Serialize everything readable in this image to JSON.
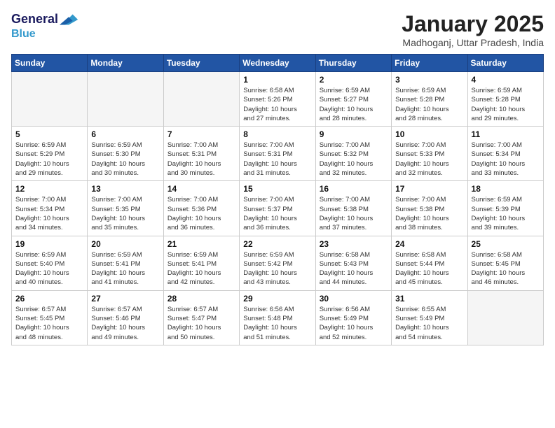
{
  "header": {
    "logo_line1": "General",
    "logo_line2": "Blue",
    "month": "January 2025",
    "location": "Madhoganj, Uttar Pradesh, India"
  },
  "days_of_week": [
    "Sunday",
    "Monday",
    "Tuesday",
    "Wednesday",
    "Thursday",
    "Friday",
    "Saturday"
  ],
  "weeks": [
    [
      {
        "day": "",
        "info": ""
      },
      {
        "day": "",
        "info": ""
      },
      {
        "day": "",
        "info": ""
      },
      {
        "day": "1",
        "info": "Sunrise: 6:58 AM\nSunset: 5:26 PM\nDaylight: 10 hours\nand 27 minutes."
      },
      {
        "day": "2",
        "info": "Sunrise: 6:59 AM\nSunset: 5:27 PM\nDaylight: 10 hours\nand 28 minutes."
      },
      {
        "day": "3",
        "info": "Sunrise: 6:59 AM\nSunset: 5:28 PM\nDaylight: 10 hours\nand 28 minutes."
      },
      {
        "day": "4",
        "info": "Sunrise: 6:59 AM\nSunset: 5:28 PM\nDaylight: 10 hours\nand 29 minutes."
      }
    ],
    [
      {
        "day": "5",
        "info": "Sunrise: 6:59 AM\nSunset: 5:29 PM\nDaylight: 10 hours\nand 29 minutes."
      },
      {
        "day": "6",
        "info": "Sunrise: 6:59 AM\nSunset: 5:30 PM\nDaylight: 10 hours\nand 30 minutes."
      },
      {
        "day": "7",
        "info": "Sunrise: 7:00 AM\nSunset: 5:31 PM\nDaylight: 10 hours\nand 30 minutes."
      },
      {
        "day": "8",
        "info": "Sunrise: 7:00 AM\nSunset: 5:31 PM\nDaylight: 10 hours\nand 31 minutes."
      },
      {
        "day": "9",
        "info": "Sunrise: 7:00 AM\nSunset: 5:32 PM\nDaylight: 10 hours\nand 32 minutes."
      },
      {
        "day": "10",
        "info": "Sunrise: 7:00 AM\nSunset: 5:33 PM\nDaylight: 10 hours\nand 32 minutes."
      },
      {
        "day": "11",
        "info": "Sunrise: 7:00 AM\nSunset: 5:34 PM\nDaylight: 10 hours\nand 33 minutes."
      }
    ],
    [
      {
        "day": "12",
        "info": "Sunrise: 7:00 AM\nSunset: 5:34 PM\nDaylight: 10 hours\nand 34 minutes."
      },
      {
        "day": "13",
        "info": "Sunrise: 7:00 AM\nSunset: 5:35 PM\nDaylight: 10 hours\nand 35 minutes."
      },
      {
        "day": "14",
        "info": "Sunrise: 7:00 AM\nSunset: 5:36 PM\nDaylight: 10 hours\nand 36 minutes."
      },
      {
        "day": "15",
        "info": "Sunrise: 7:00 AM\nSunset: 5:37 PM\nDaylight: 10 hours\nand 36 minutes."
      },
      {
        "day": "16",
        "info": "Sunrise: 7:00 AM\nSunset: 5:38 PM\nDaylight: 10 hours\nand 37 minutes."
      },
      {
        "day": "17",
        "info": "Sunrise: 7:00 AM\nSunset: 5:38 PM\nDaylight: 10 hours\nand 38 minutes."
      },
      {
        "day": "18",
        "info": "Sunrise: 6:59 AM\nSunset: 5:39 PM\nDaylight: 10 hours\nand 39 minutes."
      }
    ],
    [
      {
        "day": "19",
        "info": "Sunrise: 6:59 AM\nSunset: 5:40 PM\nDaylight: 10 hours\nand 40 minutes."
      },
      {
        "day": "20",
        "info": "Sunrise: 6:59 AM\nSunset: 5:41 PM\nDaylight: 10 hours\nand 41 minutes."
      },
      {
        "day": "21",
        "info": "Sunrise: 6:59 AM\nSunset: 5:41 PM\nDaylight: 10 hours\nand 42 minutes."
      },
      {
        "day": "22",
        "info": "Sunrise: 6:59 AM\nSunset: 5:42 PM\nDaylight: 10 hours\nand 43 minutes."
      },
      {
        "day": "23",
        "info": "Sunrise: 6:58 AM\nSunset: 5:43 PM\nDaylight: 10 hours\nand 44 minutes."
      },
      {
        "day": "24",
        "info": "Sunrise: 6:58 AM\nSunset: 5:44 PM\nDaylight: 10 hours\nand 45 minutes."
      },
      {
        "day": "25",
        "info": "Sunrise: 6:58 AM\nSunset: 5:45 PM\nDaylight: 10 hours\nand 46 minutes."
      }
    ],
    [
      {
        "day": "26",
        "info": "Sunrise: 6:57 AM\nSunset: 5:45 PM\nDaylight: 10 hours\nand 48 minutes."
      },
      {
        "day": "27",
        "info": "Sunrise: 6:57 AM\nSunset: 5:46 PM\nDaylight: 10 hours\nand 49 minutes."
      },
      {
        "day": "28",
        "info": "Sunrise: 6:57 AM\nSunset: 5:47 PM\nDaylight: 10 hours\nand 50 minutes."
      },
      {
        "day": "29",
        "info": "Sunrise: 6:56 AM\nSunset: 5:48 PM\nDaylight: 10 hours\nand 51 minutes."
      },
      {
        "day": "30",
        "info": "Sunrise: 6:56 AM\nSunset: 5:49 PM\nDaylight: 10 hours\nand 52 minutes."
      },
      {
        "day": "31",
        "info": "Sunrise: 6:55 AM\nSunset: 5:49 PM\nDaylight: 10 hours\nand 54 minutes."
      },
      {
        "day": "",
        "info": ""
      }
    ]
  ]
}
